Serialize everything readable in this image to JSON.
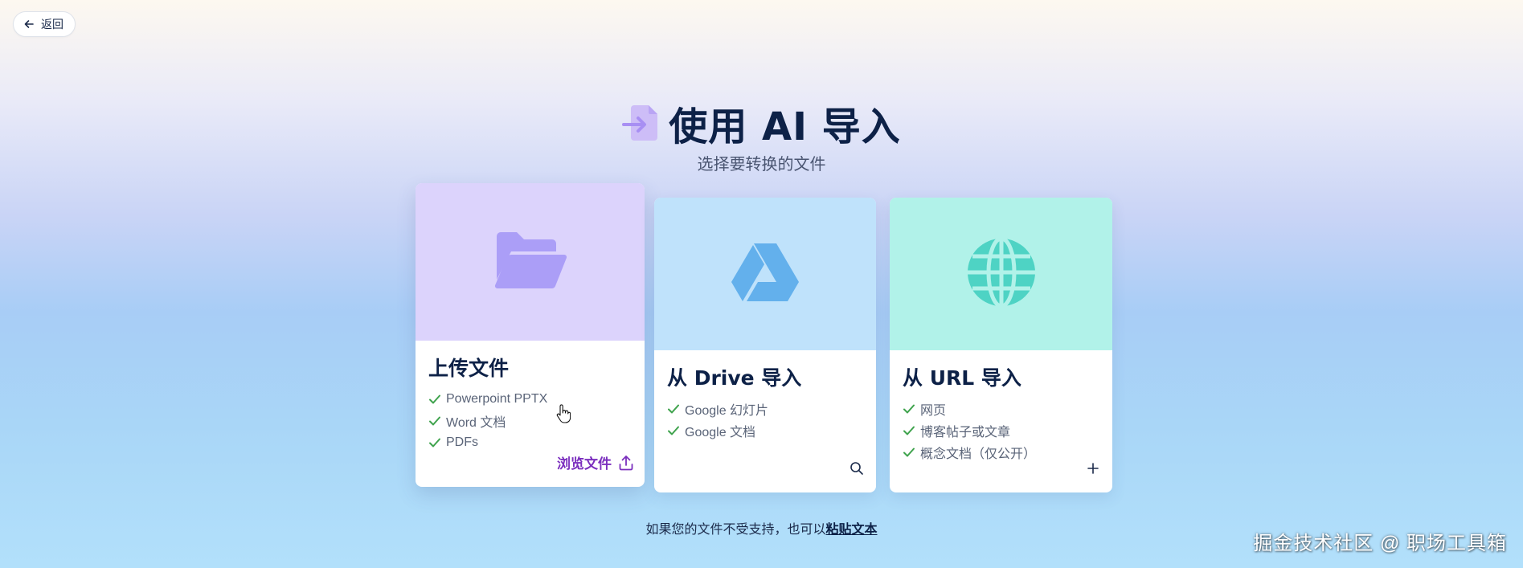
{
  "back_button": {
    "label": "返回",
    "icon": "arrow-left-icon"
  },
  "header": {
    "icon": "file-import-icon",
    "title": "使用 AI 导入",
    "subtitle": "选择要转换的文件"
  },
  "cards": {
    "upload": {
      "title": "上传文件",
      "hero_icon": "folder-open-icon",
      "features": [
        "Powerpoint PPTX",
        "Word 文档",
        "PDFs"
      ],
      "action_label": "浏览文件",
      "action_icon": "upload-icon",
      "hero_color": "#dcd3fc",
      "icon_color": "#ab9ef7"
    },
    "drive": {
      "title": "从 Drive 导入",
      "hero_icon": "google-drive-icon",
      "features": [
        "Google 幻灯片",
        "Google 文档"
      ],
      "action_icon": "search-icon",
      "hero_color": "#bfe2fb",
      "icon_color": "#63b0ec"
    },
    "url": {
      "title": "从 URL 导入",
      "hero_icon": "globe-icon",
      "features": [
        "网页",
        "博客帖子或文章",
        "概念文档（仅公开）"
      ],
      "action_icon": "plus-icon",
      "hero_color": "#b1f2e9",
      "icon_color": "#4ed3c4"
    }
  },
  "footer": {
    "text": "如果您的文件不受支持，也可以",
    "link": "粘贴文本"
  },
  "watermark": "掘金技术社区 @ 职场工具箱",
  "colors": {
    "check": "#3fa34d",
    "accent_purple": "#7b2fbe",
    "title_navy": "#0d2147"
  }
}
